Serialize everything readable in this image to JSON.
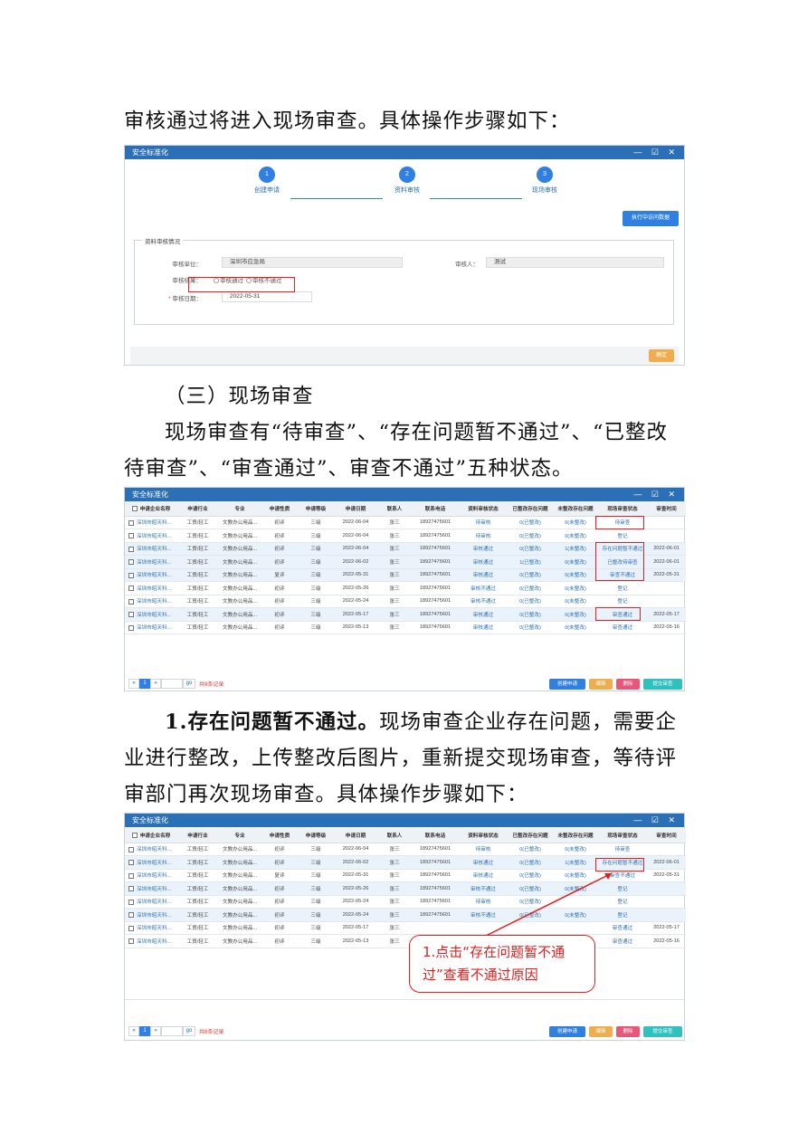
{
  "text": {
    "p1": "审核通过将进入现场审查。具体操作步骤如下：",
    "h3": "（三）现场审查",
    "p2": "现场审查有“待审查”、“存在问题暂不通过”、“已整改待审查”、“审查通过”、审查不通过”五种状态。",
    "p3_bold": "1.存在问题暂不通过。",
    "p3_rest": "现场审查企业存在问题，需要企业进行整改，上传整改后图片，重新提交现场审查，等待评审部门再次现场审查。具体操作步骤如下："
  },
  "win1": {
    "title": "安全标准化",
    "controls": "— ☑ ✕",
    "steps": [
      {
        "num": "1",
        "label": "创建申请"
      },
      {
        "num": "2",
        "label": "资料审核"
      },
      {
        "num": "3",
        "label": "现场审核"
      }
    ],
    "view_button": "执行中访问数据",
    "section_legend": "资料审核情况",
    "fields": {
      "unit_label": "审核单位：",
      "unit_value": "深圳市应急局",
      "auditor_label": "审核人：",
      "auditor_value": "测试",
      "result_label": "审核结果：",
      "result_pass": "审核通过",
      "result_fail": "审核不通过",
      "date_label": "审核日期：",
      "date_value": "2022-05-31"
    },
    "ok_button": "确定"
  },
  "headers": [
    "申请企业名称",
    "申请行业",
    "专业",
    "申请性质",
    "申请等级",
    "申请日期",
    "联系人",
    "联系电话",
    "资料审核状态",
    "已整改存在问题",
    "未整改存在问题",
    "现场审查状态",
    "审查时间"
  ],
  "table1": {
    "title": "安全标准化",
    "controls": "— ☑ ✕",
    "rows": [
      [
        "深圳市昭天科...",
        "工贸/轻工",
        "文教办公用品...",
        "初评",
        "三级",
        "2022-06-04",
        "张三",
        "18927475601",
        "待审核",
        "0(已整改)",
        "0(未整改)",
        "待审查",
        ""
      ],
      [
        "深圳市昭天科...",
        "工贸/轻工",
        "文教办公用品...",
        "初评",
        "三级",
        "2022-06-04",
        "张三",
        "18927475601",
        "待审核",
        "0(已整改)",
        "0(未整改)",
        "登记",
        ""
      ],
      [
        "深圳市昭天科...",
        "工贸/轻工",
        "文教办公用品...",
        "初评",
        "三级",
        "2022-06-04",
        "张三",
        "18927475601",
        "审核通过",
        "0(已整改)",
        "1(未整改)",
        "存在问题暂不通过",
        "2022-06-01"
      ],
      [
        "深圳市昭天科...",
        "工贸/轻工",
        "文教办公用品...",
        "初评",
        "三级",
        "2022-06-02",
        "张三",
        "18927475601",
        "审核通过",
        "1(已整改)",
        "0(未整改)",
        "已整改待审查",
        "2022-06-01"
      ],
      [
        "深圳市昭天科...",
        "工贸/轻工",
        "文教办公用品...",
        "复评",
        "三级",
        "2022-05-31",
        "张三",
        "18927475601",
        "审核通过",
        "0(已整改)",
        "0(未整改)",
        "审查不通过",
        "2022-05-31"
      ],
      [
        "深圳市昭天科...",
        "工贸/轻工",
        "文教办公用品...",
        "初评",
        "三级",
        "2022-05-26",
        "张三",
        "18927475601",
        "审核不通过",
        "0(已整改)",
        "0(未整改)",
        "登记",
        ""
      ],
      [
        "深圳市昭天科...",
        "工贸/轻工",
        "文教办公用品...",
        "初评",
        "三级",
        "2022-05-24",
        "张三",
        "18927475601",
        "审核不通过",
        "0(已整改)",
        "0(未整改)",
        "登记",
        ""
      ],
      [
        "深圳市昭天科...",
        "工贸/轻工",
        "文教办公用品...",
        "初评",
        "三级",
        "2022-05-17",
        "张三",
        "18927475601",
        "审核通过",
        "0(已整改)",
        "0(未整改)",
        "审查通过",
        "2022-05-17"
      ],
      [
        "深圳市昭天科...",
        "工贸/轻工",
        "文教办公用品...",
        "初评",
        "三级",
        "2022-05-13",
        "张三",
        "18927475601",
        "审核通过",
        "0(已整改)",
        "0(未整改)",
        "审查通过",
        "2022-05-16"
      ]
    ],
    "total": "共9条记录",
    "buttons": [
      "创建申请",
      "编辑",
      "删除",
      "提交审查"
    ]
  },
  "table2": {
    "title": "安全标准化",
    "controls": "— ☑ ✕",
    "rows": [
      [
        "深圳市昭天科...",
        "工贸/轻工",
        "文教办公用品...",
        "初评",
        "三级",
        "2022-06-04",
        "张三",
        "18927475601",
        "待审核",
        "0(已整改)",
        "0(未整改)",
        "待审查",
        ""
      ],
      [
        "深圳市昭天科...",
        "工贸/轻工",
        "文教办公用品...",
        "初评",
        "三级",
        "2022-06-02",
        "张三",
        "18927475601",
        "审核通过",
        "0(已整改)",
        "1(未整改)",
        "存在问题暂不通过",
        "2022-06-01"
      ],
      [
        "深圳市昭天科...",
        "工贸/轻工",
        "文教办公用品...",
        "复评",
        "三级",
        "2022-05-31",
        "张三",
        "18927475601",
        "审核通过",
        "0(已整改)",
        "0(未整改)",
        "审查不通过",
        "2022-05-31"
      ],
      [
        "深圳市昭天科...",
        "工贸/轻工",
        "文教办公用品...",
        "初评",
        "三级",
        "2022-05-26",
        "张三",
        "18927475601",
        "审核不通过",
        "0(已整改)",
        "0(未整改)",
        "登记",
        ""
      ],
      [
        "深圳市昭天科...",
        "工贸/轻工",
        "文教办公用品...",
        "初评",
        "三级",
        "2022-05-24",
        "张三",
        "18927475601",
        "待审核",
        "0(已整改)",
        "",
        "登记",
        ""
      ],
      [
        "深圳市昭天科...",
        "工贸/轻工",
        "文教办公用品...",
        "初评",
        "三级",
        "2022-05-24",
        "张三",
        "18927475601",
        "审核不通过",
        "0(已整改)",
        "0(未整改)",
        "登记",
        ""
      ],
      [
        "深圳市昭天科...",
        "工贸/轻工",
        "文教办公用品...",
        "初评",
        "三级",
        "2022-05-17",
        "张三",
        "",
        "",
        "",
        "",
        "审查通过",
        "2022-05-17"
      ],
      [
        "深圳市昭天科...",
        "工贸/轻工",
        "文教办公用品...",
        "初评",
        "三级",
        "2022-05-13",
        "张三",
        "",
        "",
        "",
        "",
        "审查通过",
        "2022-05-16"
      ]
    ],
    "total": "共8条记录",
    "buttons": [
      "创建申请",
      "编辑",
      "删除",
      "提交审查"
    ],
    "callout": "1.点击“存在问题暂不通过”查看不通过原因"
  },
  "pager": {
    "prev": "«",
    "page": "1",
    "next": "»",
    "go": "go"
  },
  "colors": {
    "brand": "#2b70b6",
    "accent": "#2f80e0",
    "warn": "#f0ad4e",
    "danger": "#e02020",
    "teal": "#2fc0c0"
  }
}
